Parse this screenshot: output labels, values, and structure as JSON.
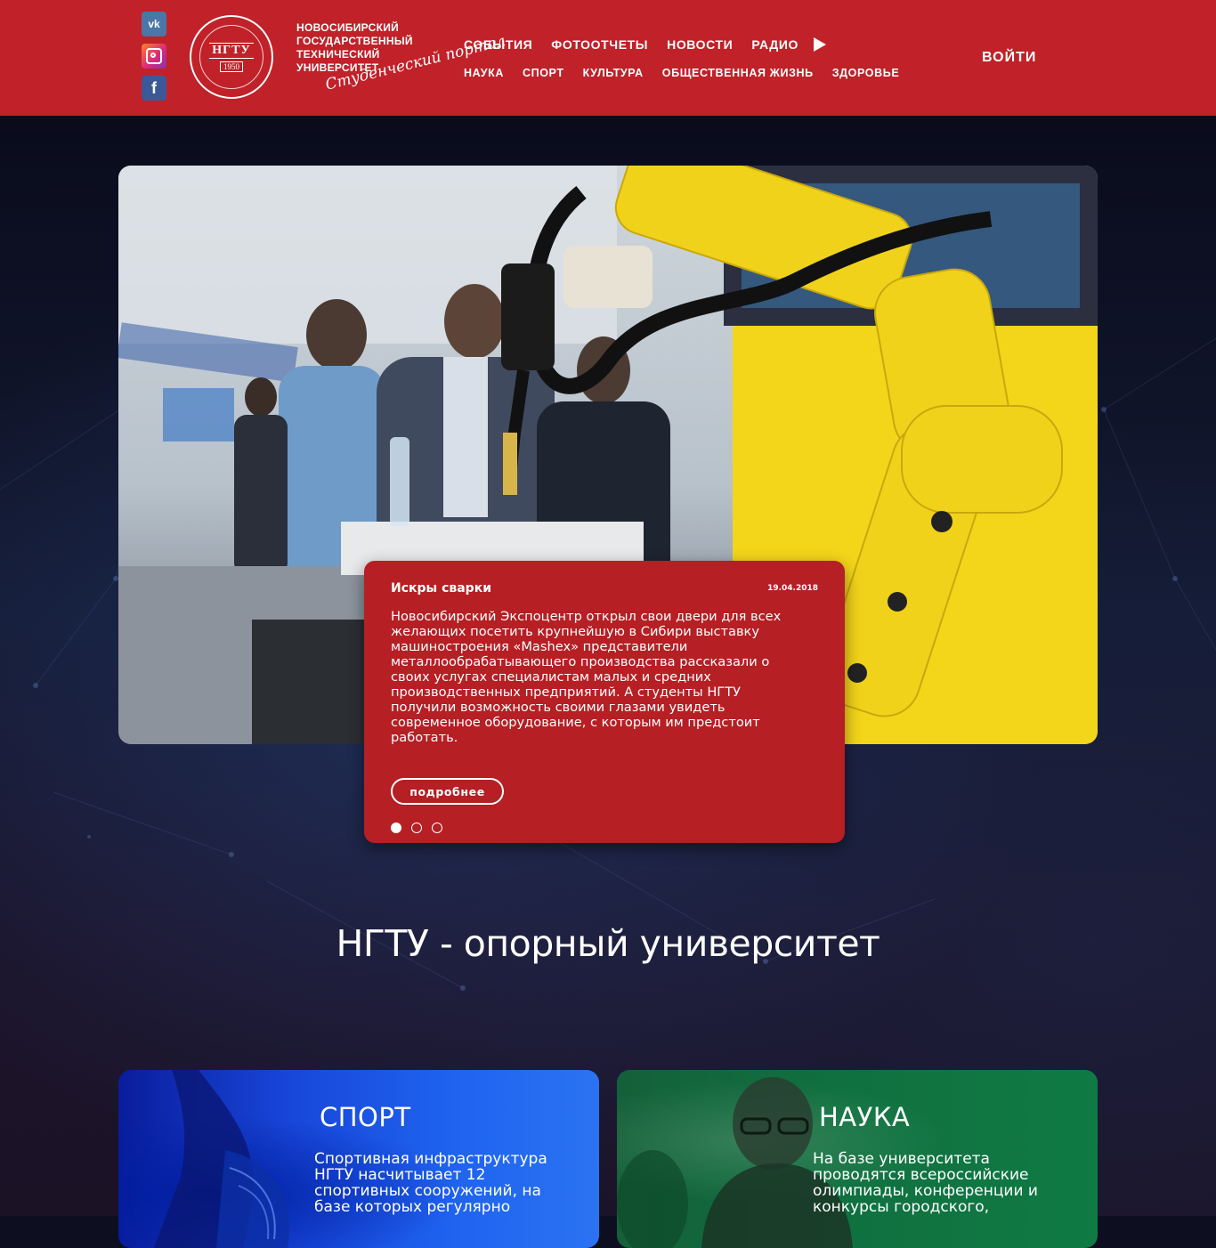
{
  "header": {
    "social": [
      {
        "name": "vk",
        "label": "vk"
      },
      {
        "name": "instagram",
        "label": ""
      },
      {
        "name": "facebook",
        "label": "f"
      }
    ],
    "emblem": {
      "abbr": "НГТУ",
      "year": "1950"
    },
    "university_name": [
      "НОВОСИБИРСКИЙ",
      "ГОСУДАРСТВЕННЫЙ",
      "ТЕХНИЧЕСКИЙ",
      "УНИВЕРСИТЕТ"
    ],
    "portal_label": "Студенческий портал",
    "nav_primary": [
      "СОБЫТИЯ",
      "ФОТООТЧЕТЫ",
      "НОВОСТИ",
      "РАДИО"
    ],
    "nav_secondary": [
      "НАУКА",
      "СПОРТ",
      "КУЛЬТУРА",
      "ОБЩЕСТВЕННАЯ ЖИЗНЬ",
      "ЗДОРОВЬЕ"
    ],
    "login_label": "ВОЙТИ",
    "colors": {
      "brand": "#c12128"
    }
  },
  "slider": {
    "title": "Искры сварки",
    "date": "19.04.2018",
    "text": "Новосибирский Экспоцентр открыл свои двери для всех желающих посетить крупнейшую в Сибири выставку машиностроения «Mashex» представители металлообрабатывающего производства рассказали о своих услугах специалистам малых и средних производственных предприятий. А студенты НГТУ получили возможность своими глазами увидеть современное оборудование, с которым им предстоит работать.",
    "more_label": "подробнее",
    "slide_count": 3,
    "active_slide": 1,
    "card_color": "#b61f24"
  },
  "section": {
    "title": "НГТУ - опорный университет"
  },
  "cards": {
    "sport": {
      "title": "СПОРТ",
      "text": "Спортивная инфраструктура НГТУ насчитывает 12 спортивных сооружений, на базе которых регулярно"
    },
    "science": {
      "title": "НАУКА",
      "text": "На базе университета проводятся всероссийские олимпиады, конференции и конкурсы городского,"
    }
  }
}
